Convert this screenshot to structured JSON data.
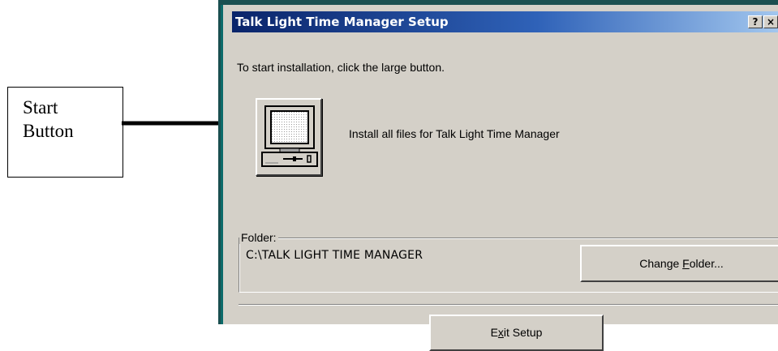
{
  "annotation": {
    "callout_lines": [
      "Start",
      "Button"
    ]
  },
  "window": {
    "title": "Talk Light Time Manager Setup",
    "help_button": "?",
    "close_button": "×",
    "intro_text": "To start installation, click the large button.",
    "install_text": "Install all files for Talk Light Time Manager",
    "folder_label": "Folder:",
    "folder_path": "C:\\TALK LIGHT TIME MANAGER",
    "change_folder_button": {
      "pre": "Change ",
      "accel": "F",
      "post": "older..."
    },
    "exit_button": {
      "pre": "E",
      "accel": "x",
      "post": "it Setup"
    }
  },
  "colors": {
    "titlebar_start": "#0a246a",
    "titlebar_end": "#a6caf0",
    "dialog_face": "#d4d0c8",
    "window_frame": "#1a4f50"
  },
  "icons": {
    "big_button_icon": "computer-icon"
  }
}
